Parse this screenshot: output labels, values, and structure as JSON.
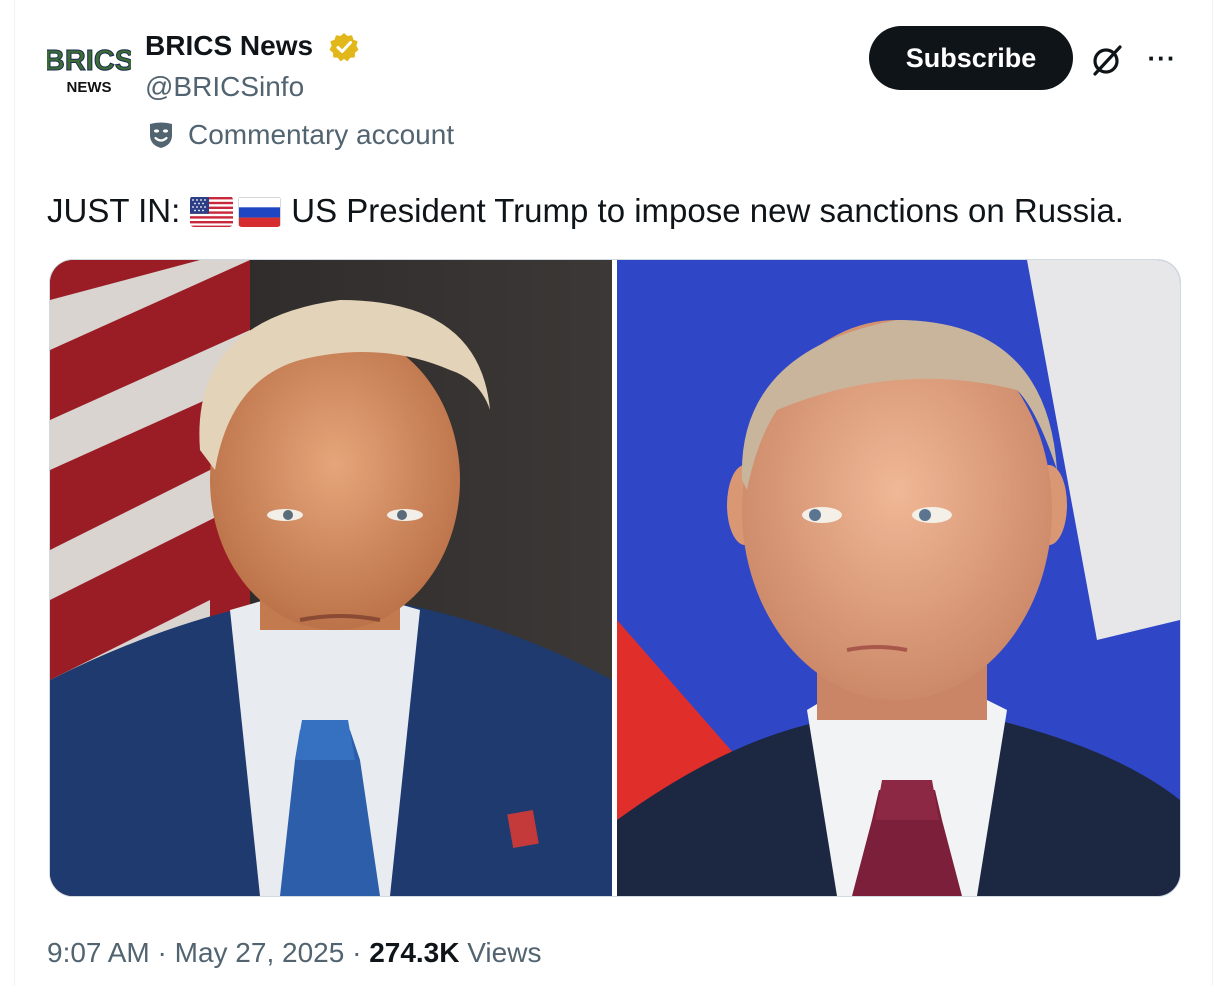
{
  "account": {
    "display_name": "BRICS News",
    "handle": "@BRICSinfo",
    "label": "Commentary account",
    "avatar_text_top": "BRICS",
    "avatar_text_bottom": "NEWS",
    "verified_color": "#e2b719"
  },
  "actions": {
    "subscribe_label": "Subscribe",
    "grok_icon": "grok-icon",
    "more_icon": "more-icon",
    "more_glyph": "···"
  },
  "tweet": {
    "prefix": "JUST IN:",
    "flags": [
      "us-flag",
      "russia-flag"
    ],
    "body": "US President Trump to impose new sanctions on Russia."
  },
  "media": {
    "images": [
      {
        "name": "trump-photo"
      },
      {
        "name": "putin-photo"
      }
    ]
  },
  "meta": {
    "time": "9:07 AM",
    "separator": "·",
    "date": "May 27, 2025",
    "views_count": "274.3K",
    "views_label": "Views"
  },
  "colors": {
    "text": "#0f1419",
    "secondary": "#536471",
    "border": "#cfd9de",
    "button_bg": "#0f1419"
  }
}
